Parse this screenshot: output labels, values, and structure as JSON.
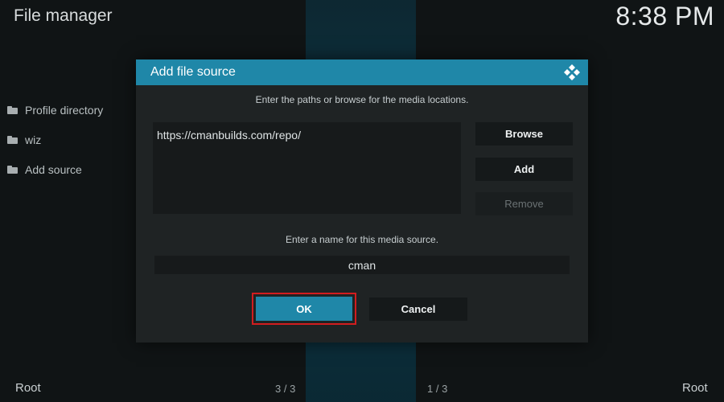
{
  "app": {
    "title": "File manager",
    "clock": "8:38 PM"
  },
  "sidebar": {
    "items": [
      {
        "label": "Profile directory",
        "icon": "folder-icon"
      },
      {
        "label": "wiz",
        "icon": "folder-icon"
      },
      {
        "label": "Add source",
        "icon": "folder-icon"
      }
    ]
  },
  "footer": {
    "left": "Root",
    "left_count": "3 / 3",
    "right_count": "1 / 3",
    "right": "Root"
  },
  "dialog": {
    "title": "Add file source",
    "paths_instruction": "Enter the paths or browse for the media locations.",
    "path_value": "https://cmanbuilds.com/repo/",
    "browse_label": "Browse",
    "add_label": "Add",
    "remove_label": "Remove",
    "name_instruction": "Enter a name for this media source.",
    "name_value": "cman",
    "ok_label": "OK",
    "cancel_label": "Cancel"
  },
  "colors": {
    "accent": "#1f87a8",
    "highlight": "#d21d1f",
    "dialog_bg": "#1f2324"
  }
}
